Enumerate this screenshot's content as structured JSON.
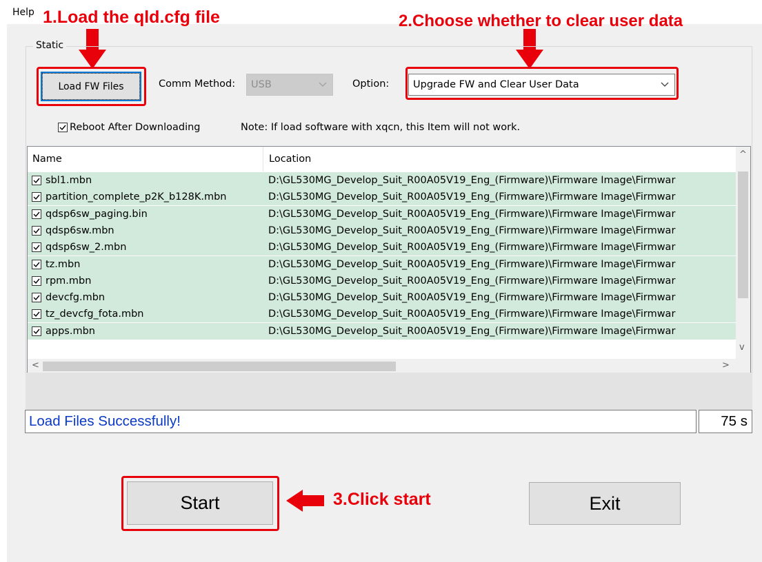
{
  "menu": {
    "help": "Help"
  },
  "annotations": {
    "step1": "1.Load the qld.cfg file",
    "step2": "2.Choose whether to clear user data",
    "step3": "3.Click start",
    "color": "#e8000b"
  },
  "group": {
    "label": "Static"
  },
  "controls": {
    "load_button": "Load FW Files",
    "comm_method_label": "Comm Method:",
    "comm_method_value": "USB",
    "comm_method_disabled": true,
    "option_label": "Option:",
    "option_value": "Upgrade FW and Clear User Data",
    "reboot_label": "Reboot After Downloading",
    "reboot_checked": true,
    "note": "Note: If load software with xqcn, this Item will not work."
  },
  "table": {
    "columns": [
      "Name",
      "Location"
    ],
    "rows": [
      {
        "checked": true,
        "name": "sbl1.mbn",
        "location": "D:\\GL530MG_Develop_Suit_R00A05V19_Eng_(Firmware)\\Firmware Image\\Firmwar"
      },
      {
        "checked": true,
        "name": "partition_complete_p2K_b128K.mbn",
        "location": "D:\\GL530MG_Develop_Suit_R00A05V19_Eng_(Firmware)\\Firmware Image\\Firmwar"
      },
      {
        "checked": true,
        "name": "qdsp6sw_paging.bin",
        "location": "D:\\GL530MG_Develop_Suit_R00A05V19_Eng_(Firmware)\\Firmware Image\\Firmwar"
      },
      {
        "checked": true,
        "name": "qdsp6sw.mbn",
        "location": "D:\\GL530MG_Develop_Suit_R00A05V19_Eng_(Firmware)\\Firmware Image\\Firmwar"
      },
      {
        "checked": true,
        "name": "qdsp6sw_2.mbn",
        "location": "D:\\GL530MG_Develop_Suit_R00A05V19_Eng_(Firmware)\\Firmware Image\\Firmwar"
      },
      {
        "checked": true,
        "name": "tz.mbn",
        "location": "D:\\GL530MG_Develop_Suit_R00A05V19_Eng_(Firmware)\\Firmware Image\\Firmwar"
      },
      {
        "checked": true,
        "name": "rpm.mbn",
        "location": "D:\\GL530MG_Develop_Suit_R00A05V19_Eng_(Firmware)\\Firmware Image\\Firmwar"
      },
      {
        "checked": true,
        "name": "devcfg.mbn",
        "location": "D:\\GL530MG_Develop_Suit_R00A05V19_Eng_(Firmware)\\Firmware Image\\Firmwar"
      },
      {
        "checked": true,
        "name": "tz_devcfg_fota.mbn",
        "location": "D:\\GL530MG_Develop_Suit_R00A05V19_Eng_(Firmware)\\Firmware Image\\Firmwar"
      },
      {
        "checked": true,
        "name": "apps.mbn",
        "location": "D:\\GL530MG_Develop_Suit_R00A05V19_Eng_(Firmware)\\Firmware Image\\Firmwar"
      }
    ],
    "row_color": "#d1eadb"
  },
  "status": {
    "message": "Load Files Successfully!",
    "message_color": "#0a39c5",
    "timer": "75 s"
  },
  "buttons": {
    "start": "Start",
    "exit": "Exit"
  }
}
